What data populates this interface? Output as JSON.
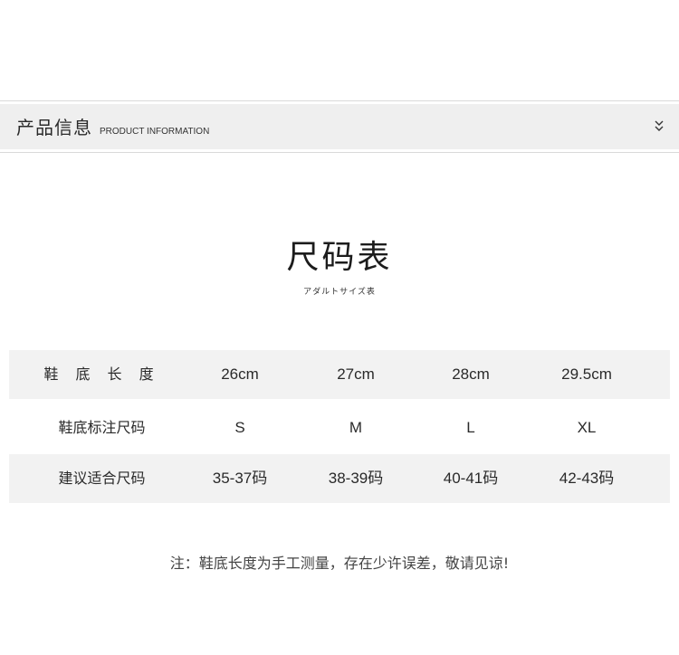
{
  "header": {
    "title": "产品信息",
    "subtitle": "PRODUCT INFORMATION",
    "toggle_icon": "double-chevron-down-icon"
  },
  "size_chart": {
    "title": "尺码表",
    "subtitle": "アダルトサイズ表",
    "rows": [
      {
        "label": "鞋 底 长 度",
        "values": [
          "26cm",
          "27cm",
          "28cm",
          "29.5cm"
        ]
      },
      {
        "label": "鞋底标注尺码",
        "values": [
          "S",
          "M",
          "L",
          "XL"
        ]
      },
      {
        "label": "建议适合尺码",
        "values": [
          "35-37码",
          "38-39码",
          "40-41码",
          "42-43码"
        ]
      }
    ]
  },
  "note": "注：鞋底长度为手工测量，存在少许误差，敬请见谅!",
  "colors": {
    "header_bg": "#efefef",
    "row_shade": "#f2f2f2",
    "text": "#2a2a2a"
  }
}
